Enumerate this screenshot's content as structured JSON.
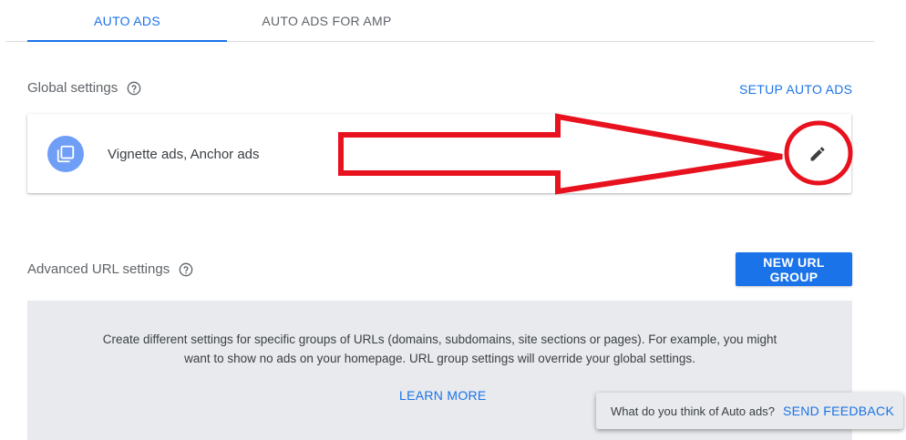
{
  "tabs": [
    {
      "label": "AUTO ADS",
      "active": true
    },
    {
      "label": "AUTO ADS FOR AMP",
      "active": false
    }
  ],
  "global_settings": {
    "title": "Global settings",
    "help_icon": "help-circle-icon",
    "setup_link": "SETUP AUTO ADS",
    "card_icon": "ad-formats-icon",
    "card_label": "Vignette ads, Anchor ads",
    "edit_icon": "pencil-icon"
  },
  "advanced_url_settings": {
    "title": "Advanced URL settings",
    "help_icon": "help-circle-icon",
    "new_group_button": "NEW URL GROUP",
    "description": "Create different settings for specific groups of URLs (domains, subdomains, site sections or pages). For example, you might want to show no ads on your homepage. URL group settings will override your global settings.",
    "learn_more": "LEARN MORE"
  },
  "feedback": {
    "question": "What do you think of Auto ads?",
    "link": "SEND FEEDBACK"
  },
  "colors": {
    "accent": "#1a73e8",
    "annotation": "#e8121f",
    "panel": "#e8eaed"
  }
}
